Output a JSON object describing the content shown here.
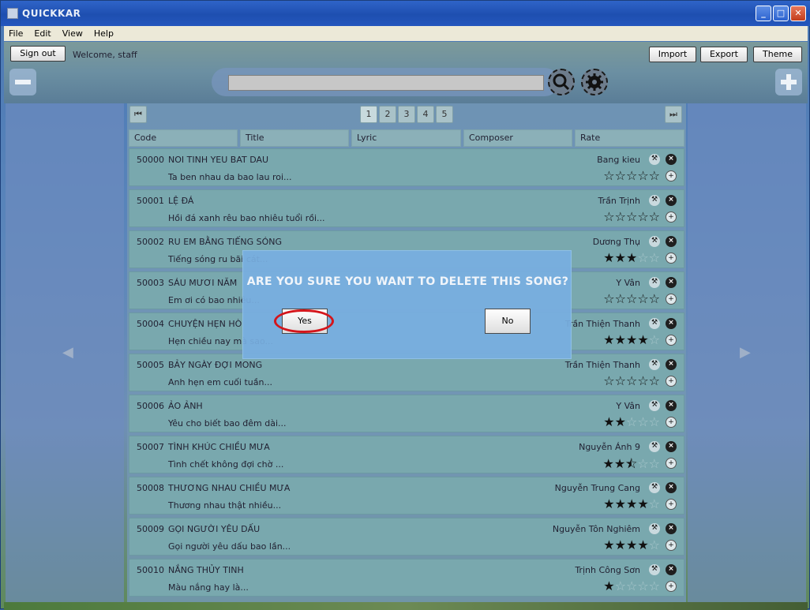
{
  "window": {
    "title": "QUICKKAR",
    "controls": {
      "minimize": "_",
      "maximize": "□",
      "close": "✕"
    }
  },
  "menu": [
    "File",
    "Edit",
    "View",
    "Help"
  ],
  "header": {
    "sign_out": "Sign out",
    "welcome": "Welcome, staff",
    "import": "Import",
    "export": "Export",
    "theme": "Theme",
    "search_value": "",
    "icons": {
      "remove": "minus-icon",
      "search": "magnifier-icon",
      "settings": "gear-icon",
      "add": "plus-icon"
    }
  },
  "pagination": {
    "first": "⏮",
    "last": "⏭",
    "pages": [
      "1",
      "2",
      "3",
      "4",
      "5"
    ],
    "current": "1"
  },
  "columns": [
    "Code",
    "Title",
    "Lyric",
    "Composer",
    "Rate"
  ],
  "songs": [
    {
      "code": "50000",
      "title": "NOI TINH YEU BAT DAU",
      "lyric": "Ta ben nhau da bao lau roi...",
      "composer": "Bang kieu",
      "rating": 0
    },
    {
      "code": "50001",
      "title": "LỆ ĐÁ",
      "lyric": "Hồi đá xanh rêu bao nhiêu tuổi rồi...",
      "composer": "Trần Trịnh",
      "rating": 0
    },
    {
      "code": "50002",
      "title": "RU EM BẰNG TIẾNG SÓNG",
      "lyric": "Tiếng sóng ru bãi cát...",
      "composer": "Dương Thụ",
      "rating": 3
    },
    {
      "code": "50003",
      "title": "SÁU MƯƠI NĂM",
      "lyric": "Em ơi có bao nhiêu...",
      "composer": "Y Vân",
      "rating": 0
    },
    {
      "code": "50004",
      "title": "CHUYỆN HẸN HÒ",
      "lyric": "Hẹn chiều nay mà sao...",
      "composer": "Trần Thiện Thanh",
      "rating": 4
    },
    {
      "code": "50005",
      "title": "BẢY NGÀY ĐỢI MONG",
      "lyric": "Anh hẹn em cuối tuần...",
      "composer": "Trần Thiện Thanh",
      "rating": 0
    },
    {
      "code": "50006",
      "title": "ẢO ẢNH",
      "lyric": "Yêu cho biết bao đêm dài...",
      "composer": "Y Vân",
      "rating": 2
    },
    {
      "code": "50007",
      "title": "TÌNH KHÚC CHIỀU MƯA",
      "lyric": "Tình chết không đợi chờ ...",
      "composer": "Nguyễn Ánh 9",
      "rating": 2.5
    },
    {
      "code": "50008",
      "title": "THƯƠNG NHAU CHIỀU MƯA",
      "lyric": "Thương nhau thật nhiều...",
      "composer": "Nguyễn Trung Cang",
      "rating": 4
    },
    {
      "code": "50009",
      "title": "GỌI NGƯỜI YÊU DẤU",
      "lyric": "Gọi người yêu dấu bao lần...",
      "composer": "Nguyễn Tôn Nghiêm",
      "rating": 4
    },
    {
      "code": "50010",
      "title": "NẮNG THỦY TINH",
      "lyric": "Màu nắng hay là...",
      "composer": "Trịnh Công Sơn",
      "rating": 1
    }
  ],
  "dialog": {
    "message": "ARE YOU SURE YOU WANT TO DELETE THIS SONG?",
    "yes": "Yes",
    "no": "No"
  },
  "side_arrows": {
    "left": "◀",
    "right": "▶"
  },
  "colors": {
    "row_bg": "#79a8ae",
    "dialog_bg": "#78afe1",
    "highlight_ring": "#d4151b"
  }
}
